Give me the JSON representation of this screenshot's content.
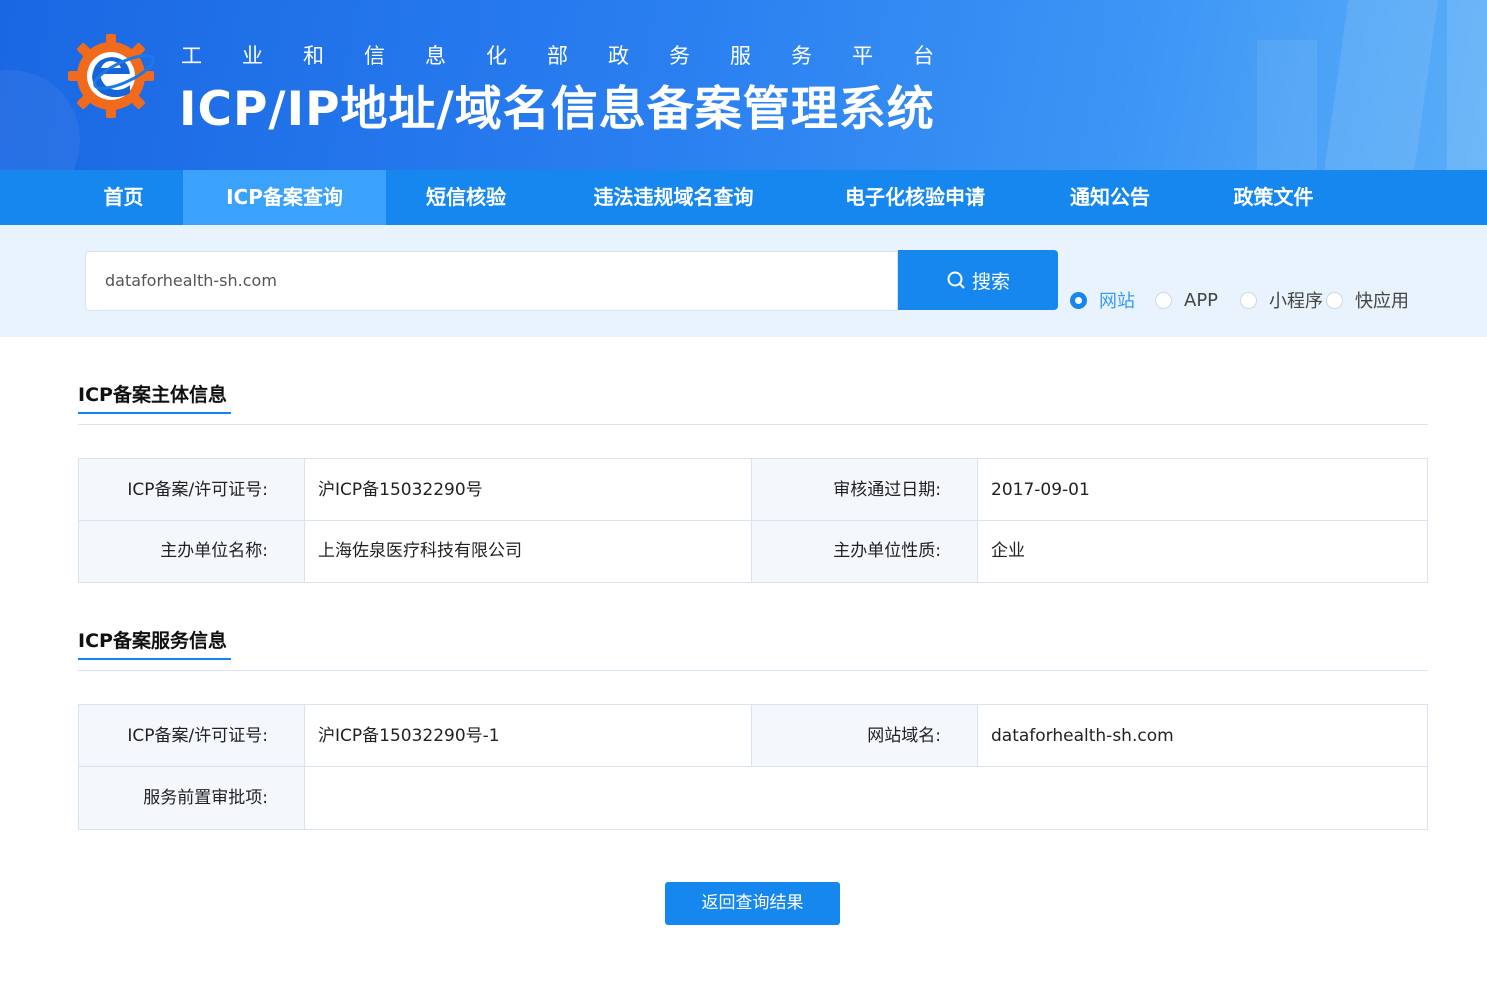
{
  "header": {
    "ministry": "工业和信息化部政务服务平台",
    "title": "ICP/IP地址/域名信息备案管理系统"
  },
  "nav": {
    "items": [
      {
        "label": "首页"
      },
      {
        "label": "ICP备案查询",
        "active": true
      },
      {
        "label": "短信核验"
      },
      {
        "label": "违法违规域名查询"
      },
      {
        "label": "电子化核验申请"
      },
      {
        "label": "通知公告"
      },
      {
        "label": "政策文件"
      }
    ]
  },
  "search": {
    "value": "dataforhealth-sh.com",
    "button_label": "搜索",
    "types": [
      {
        "label": "网站",
        "checked": true
      },
      {
        "label": "APP",
        "checked": false
      },
      {
        "label": "小程序",
        "checked": false
      },
      {
        "label": "快应用",
        "checked": false
      }
    ]
  },
  "subject": {
    "title": "ICP备案主体信息",
    "license_label": "ICP备案/许可证号:",
    "license_value": "沪ICP备15032290号",
    "approve_date_label": "审核通过日期:",
    "approve_date_value": "2017-09-01",
    "org_name_label": "主办单位名称:",
    "org_name_value": "上海佐泉医疗科技有限公司",
    "org_type_label": "主办单位性质:",
    "org_type_value": "企业"
  },
  "service": {
    "title": "ICP备案服务信息",
    "license_label": "ICP备案/许可证号:",
    "license_value": "沪ICP备15032290号-1",
    "domain_label": "网站域名:",
    "domain_value": "dataforhealth-sh.com",
    "pre_approval_label": "服务前置审批项:",
    "pre_approval_value": ""
  },
  "back_button_label": "返回查询结果",
  "colors": {
    "primary": "#1587ee",
    "nav_active": "#3aa2fa",
    "search_band": "#e9f3fd",
    "logo_orange": "#f26a1b"
  },
  "icons": {
    "logo": "ministry-gear-e-logo",
    "search": "search-icon"
  }
}
